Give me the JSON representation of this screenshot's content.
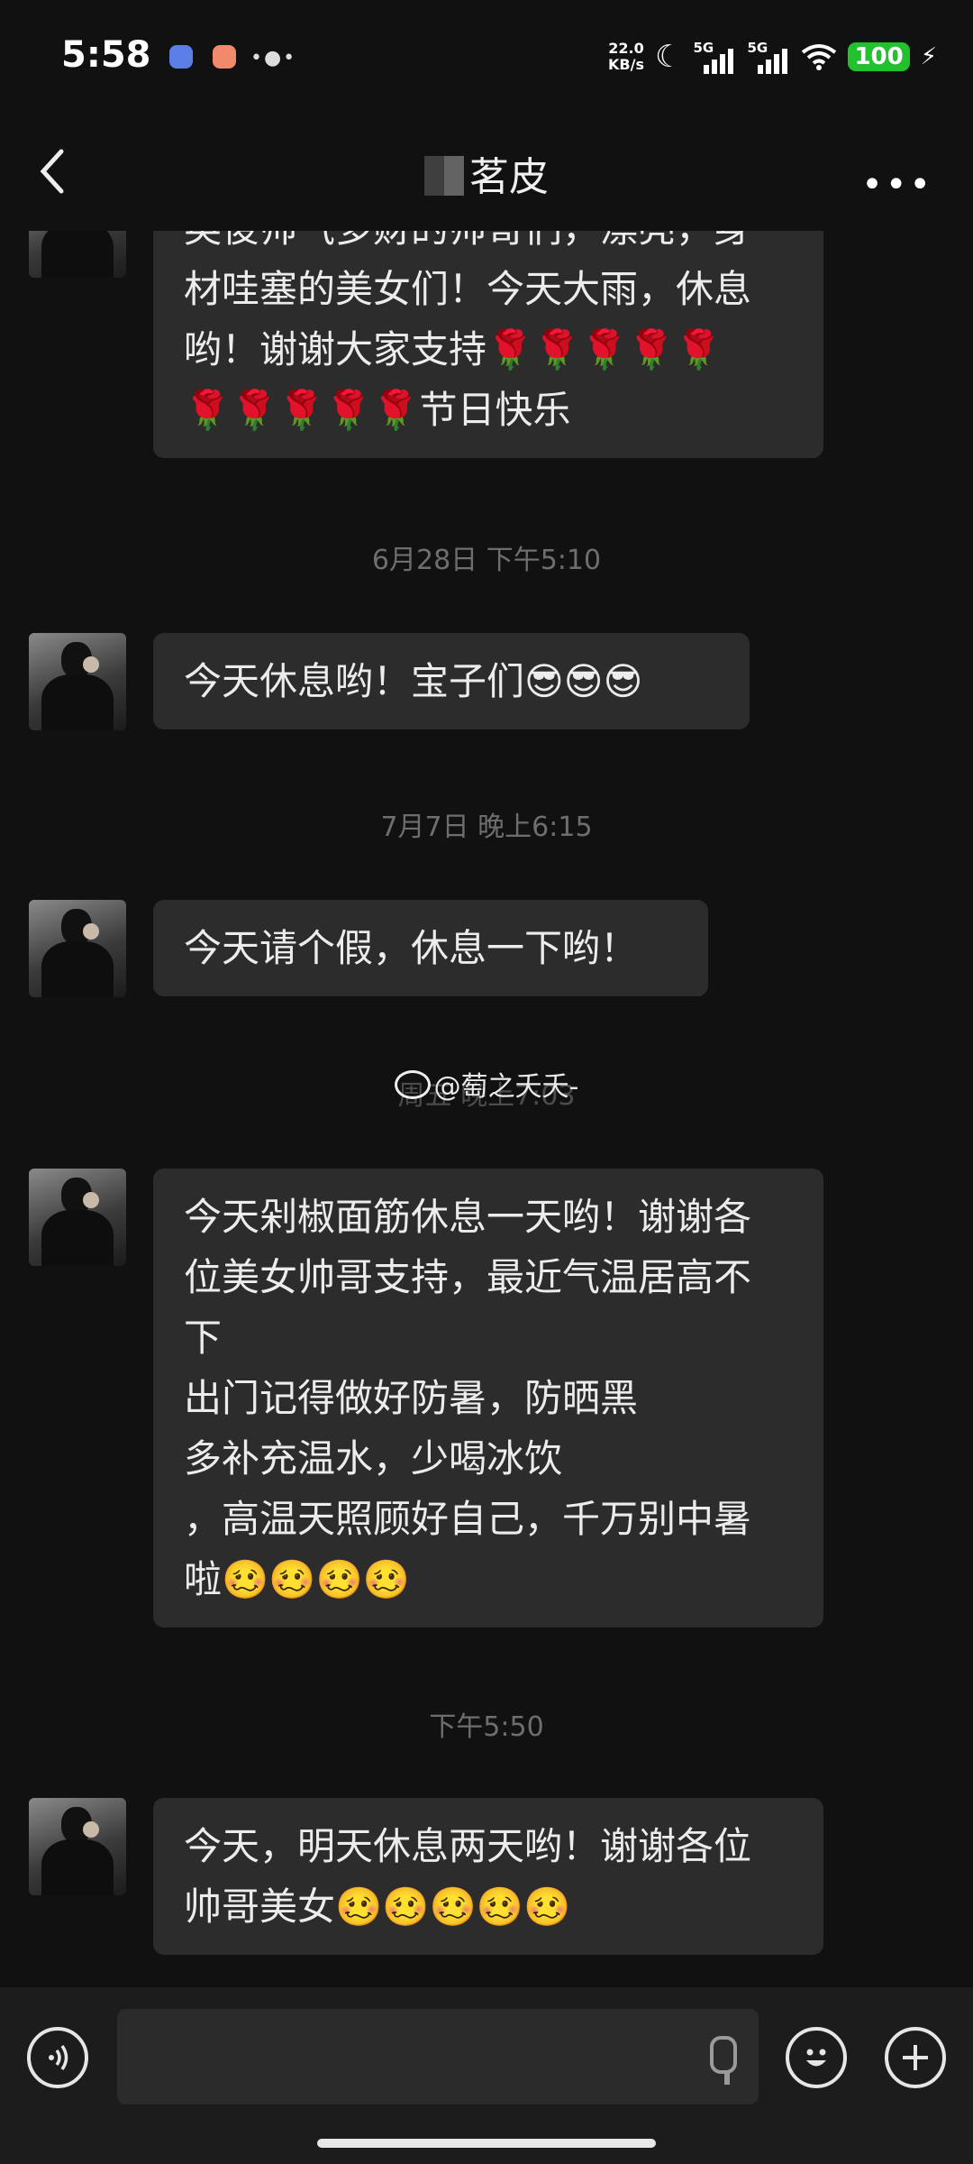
{
  "status_bar": {
    "time": "5:58",
    "net_speed_value": "22.0",
    "net_speed_unit": "KB/s",
    "signal_1_label": "5G",
    "signal_2_label": "5G",
    "battery": "100",
    "app_icon_colors": [
      "#5b7fe6",
      "#f08a6a"
    ]
  },
  "header": {
    "contact_name": "茗皮",
    "back_icon": "chevron-left-icon",
    "more_icon": "more-dots-icon"
  },
  "messages": [
    {
      "type": "received",
      "text": "英俊帅气多财的帅哥们，漂亮，身\n材哇塞的美女们！今天大雨，休息\n哟！谢谢大家支持🌹🌹🌹🌹🌹\n🌹🌹🌹🌹🌹节日快乐"
    },
    {
      "type": "timestamp",
      "text": "6月28日 下午5:10"
    },
    {
      "type": "received",
      "text": "今天休息哟！宝子们😎😎😎"
    },
    {
      "type": "timestamp",
      "text": "7月7日 晚上6:15"
    },
    {
      "type": "received",
      "text": "今天请个假，休息一下哟！"
    },
    {
      "type": "timestamp",
      "text": "周五 晚上7:03"
    },
    {
      "type": "received",
      "text": "今天剁椒面筋休息一天哟！谢谢各\n位美女帅哥支持，最近气温居高不\n下\n出门记得做好防暑，防晒黑\n多补充温水，少喝冰饮\n，高温天照顾好自己，千万别中暑\n啦🥴🥴🥴🥴"
    },
    {
      "type": "timestamp",
      "text": "下午5:50"
    },
    {
      "type": "received",
      "text": "今天，明天休息两天哟！谢谢各位\n帅哥美女🥴🥴🥴🥴🥴"
    }
  ],
  "watermark": "@萄之夭夭-",
  "input_bar": {
    "voice_icon": "voice-icon",
    "text_value": "",
    "mic_icon": "microphone-icon",
    "emoji_icon": "emoji-icon",
    "plus_icon": "plus-icon"
  }
}
